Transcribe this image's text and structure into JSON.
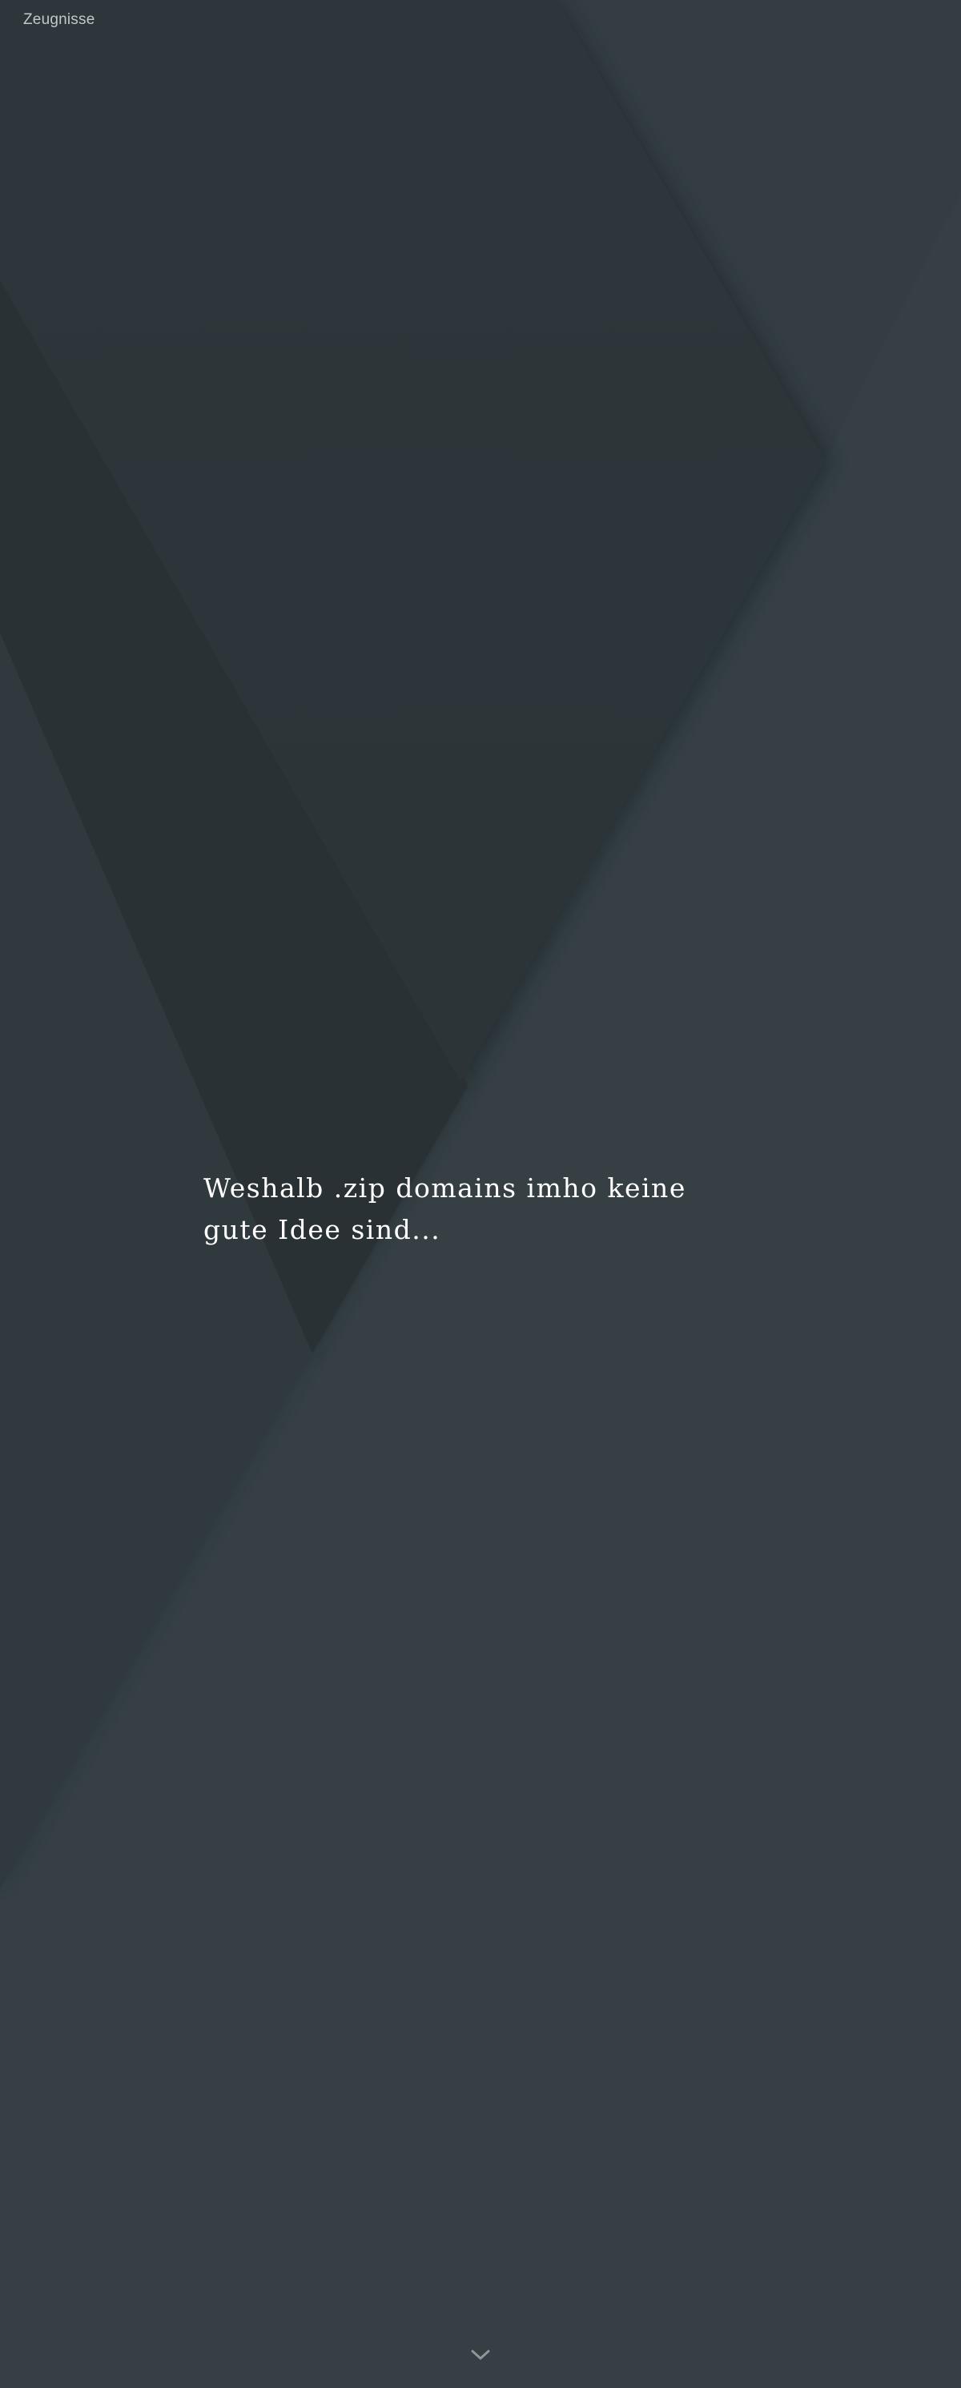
{
  "nav": {
    "link_label": "Zeugnisse"
  },
  "hero": {
    "title": "Weshalb .zip domains imho keine gute Idee sind..."
  },
  "scroll_indicator": {
    "icon": "chevron-down-icon"
  },
  "colors": {
    "background": "#353f44",
    "dark_panel": "#2c3539",
    "title_text": "#ffffff",
    "nav_text": "#c3c7ca",
    "chevron": "#8e969a"
  }
}
